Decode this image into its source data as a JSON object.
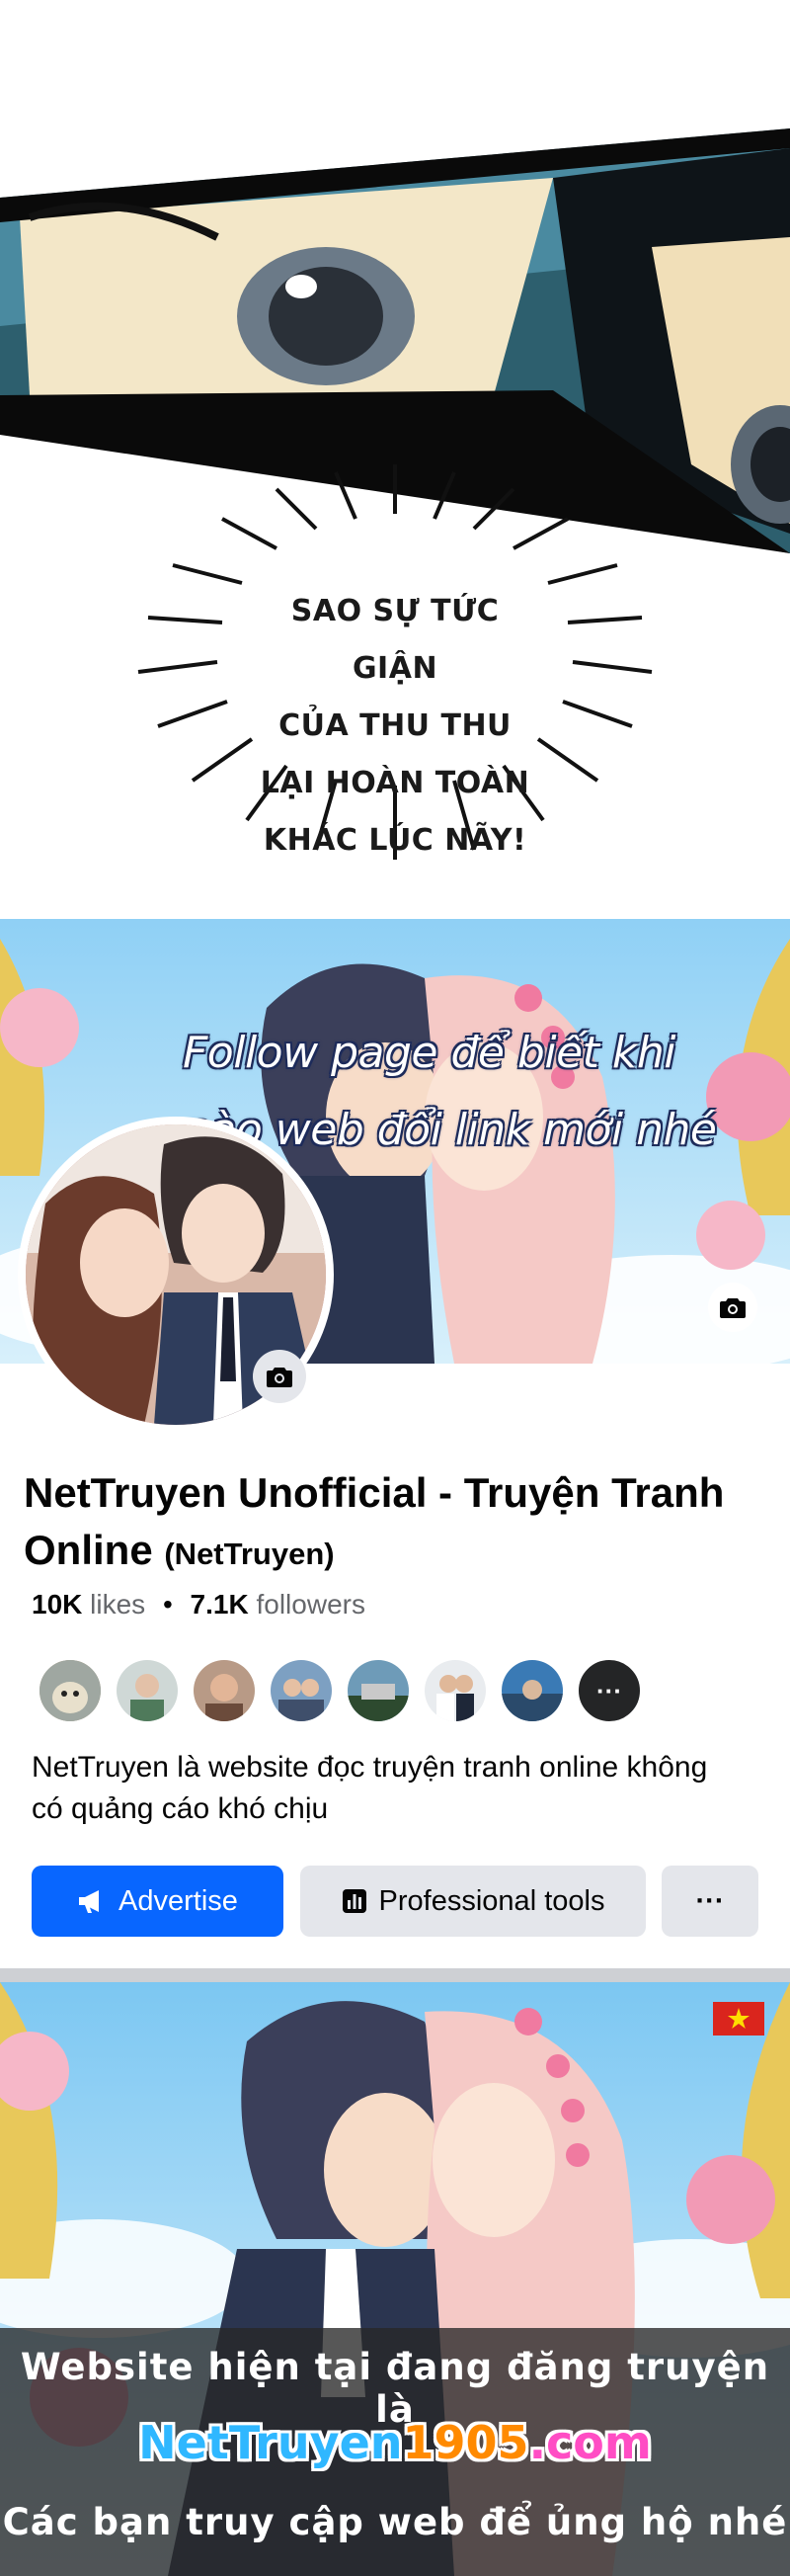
{
  "manga": {
    "speech_lines": [
      "SAO SỰ TỨC GIẬN",
      "CỦA THU THU LẠI HOÀN TOÀN",
      "KHÁC LÚC NÃY!"
    ]
  },
  "cover": {
    "caption_line1": "Follow page để biết khi",
    "caption_line2": "nào web đổi link mới nhé"
  },
  "page": {
    "name": "NetTruyen Unofficial - Truyện Tranh Online",
    "handle": "(NetTruyen)",
    "likes_count": "10K",
    "likes_label": "likes",
    "separator": "•",
    "followers_count": "7.1K",
    "followers_label": "followers",
    "more_friends": "···",
    "bio": "NetTruyen là website đọc truyện tranh online không có quảng cáo khó chịu"
  },
  "actions": {
    "advertise": "Advertise",
    "professional_tools": "Professional tools",
    "more": "···"
  },
  "banner": {
    "line1": "Website hiện tại đang đăng truyện là",
    "site_part1": "NetTruyen",
    "site_part2": "1905",
    "site_part3": ".com",
    "line3": "Các bạn truy cập web để ủng hộ nhé"
  },
  "colors": {
    "primary_button": "#0866ff",
    "secondary_button": "#e4e6eb",
    "text_secondary": "#65676b"
  },
  "icons": [
    "camera-icon",
    "megaphone-icon",
    "chart-icon",
    "more-icon",
    "vietnam-flag-icon"
  ]
}
